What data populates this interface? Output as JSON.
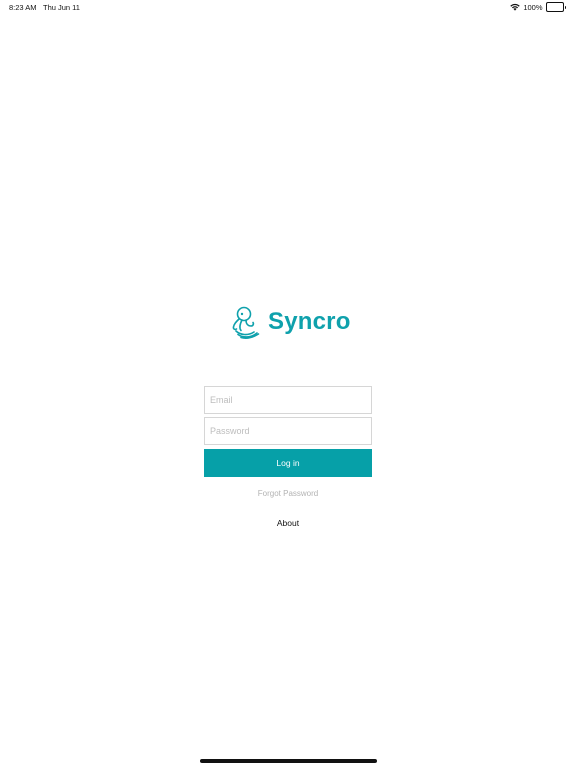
{
  "status_bar": {
    "time": "8:23 AM",
    "date": "Thu Jun 11",
    "battery_percent": "100%",
    "battery_level": 1.0,
    "wifi_icon": "wifi-icon",
    "battery_icon": "battery-icon"
  },
  "logo": {
    "text": "Syncro",
    "icon": "octopus-logo-icon",
    "color": "#0fa1ac"
  },
  "login_form": {
    "email_placeholder": "Email",
    "email_value": "",
    "password_placeholder": "Password",
    "password_value": "",
    "login_label": "Log in",
    "login_color": "#06a0a8",
    "forgot_password_label": "Forgot Password",
    "about_label": "About"
  }
}
